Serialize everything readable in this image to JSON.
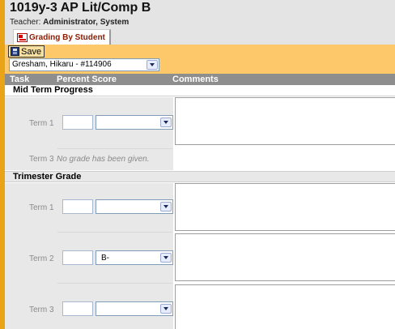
{
  "course": {
    "title": "1019y-3 AP Lit/Comp B",
    "teacher_label": "Teacher:",
    "teacher_name": "Administrator, System"
  },
  "tab": {
    "label": "Grading By Student"
  },
  "toolbar": {
    "save_label": "Save"
  },
  "student_select": {
    "selected": "Gresham, Hikaru - #114906"
  },
  "columns": {
    "task": "Task",
    "percent_score": "Percent Score",
    "comments": "Comments"
  },
  "sections": [
    {
      "title": "Mid Term Progress",
      "terms": [
        {
          "label": "Term 1",
          "percent": "",
          "grade": "",
          "comment": ""
        },
        {
          "label": "Term 3",
          "message": "No grade has been given."
        }
      ]
    },
    {
      "title": "Trimester Grade",
      "terms": [
        {
          "label": "Term 1",
          "percent": "",
          "grade": "",
          "comment": ""
        },
        {
          "label": "Term 2",
          "percent": "",
          "grade": "B-",
          "comment": ""
        },
        {
          "label": "Term 3",
          "percent": "",
          "grade": "",
          "comment": ""
        }
      ]
    }
  ],
  "colors": {
    "accent_orange": "#e8a317",
    "toolbar_bg": "#fcc86a",
    "column_header_bg": "#8e8e8e",
    "tab_text": "#8a1c00"
  },
  "icons": [
    "grading-tab-icon",
    "save-icon",
    "chevron-down-icon"
  ]
}
